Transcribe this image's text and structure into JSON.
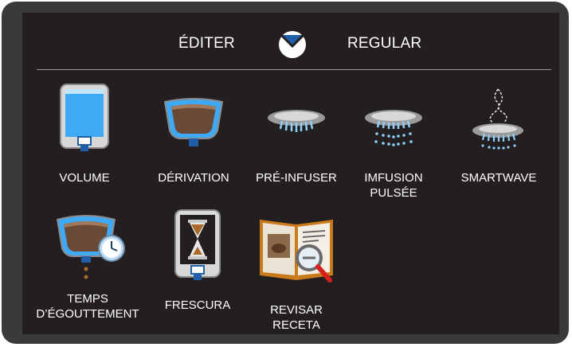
{
  "header": {
    "left_label": "ÉDITER",
    "right_label": "REGULAR",
    "logo_icon": "drop-logo-icon"
  },
  "menu": {
    "items": [
      {
        "label": "VOLUME",
        "icon": "water-tank-icon"
      },
      {
        "label": "DÉRIVATION",
        "icon": "bypass-cup-icon"
      },
      {
        "label": "PRÉ-INFUSER",
        "icon": "spray-head-icon"
      },
      {
        "label": "IMFUSION PULSÉE",
        "icon": "pulse-spray-icon"
      },
      {
        "label": "SMARTWAVE",
        "icon": "smartwave-icon"
      },
      {
        "label": "TEMPS D’ÉGOUTTEMENT",
        "icon": "drip-time-icon"
      },
      {
        "label": "FRESCURA",
        "icon": "hourglass-icon"
      },
      {
        "label": "REVISAR RECETA",
        "icon": "recipe-book-icon"
      }
    ]
  },
  "colors": {
    "screen_bg": "#231f20",
    "bezel": "#3a3a3a",
    "accent_blue": "#1f5ea8",
    "water_blue": "#3fa9f5"
  }
}
